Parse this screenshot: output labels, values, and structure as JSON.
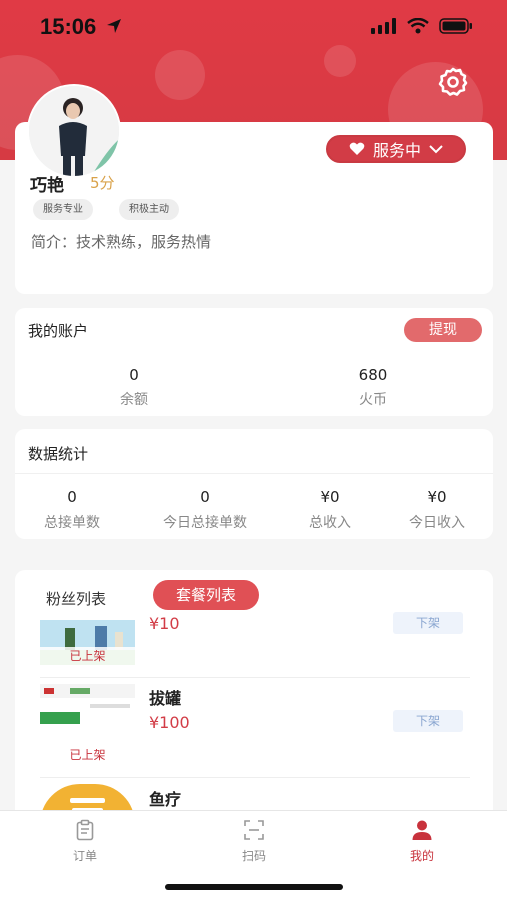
{
  "status_bar": {
    "time": "15:06"
  },
  "profile": {
    "name": "巧艳",
    "score": "5分",
    "tags": [
      "服务专业",
      "积极主动"
    ],
    "intro": "简介：技术熟练，服务热情",
    "service_status": "服务中"
  },
  "account": {
    "title": "我的账户",
    "withdraw_label": "提现",
    "stats": [
      {
        "value": "0",
        "label": "余额"
      },
      {
        "value": "680",
        "label": "火币"
      }
    ]
  },
  "data_stats": {
    "title": "数据统计",
    "stats": [
      {
        "value": "0",
        "label": "总接单数"
      },
      {
        "value": "0",
        "label": "今日总接单数"
      },
      {
        "value": "¥0",
        "label": "总收入"
      },
      {
        "value": "¥0",
        "label": "今日收入"
      }
    ]
  },
  "list": {
    "tabs": [
      "粉丝列表",
      "套餐列表"
    ],
    "active_tab": "套餐列表",
    "items": [
      {
        "name": "",
        "price": "¥10",
        "status": "已上架",
        "action": "下架"
      },
      {
        "name": "拔罐",
        "price": "¥100",
        "status": "已上架",
        "action": "下架"
      },
      {
        "name": "鱼疗",
        "price": "",
        "status": "",
        "action": ""
      }
    ]
  },
  "tabbar": {
    "items": [
      {
        "label": "订单",
        "icon": "clipboard-icon"
      },
      {
        "label": "扫码",
        "icon": "scan-icon"
      },
      {
        "label": "我的",
        "icon": "user-icon"
      }
    ],
    "active": "我的"
  },
  "colors": {
    "brand_red": "#d63a43",
    "score_gold": "#d9a24a"
  }
}
